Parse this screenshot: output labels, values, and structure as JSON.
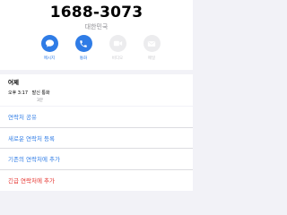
{
  "contact": {
    "phone_number": "1688-3073",
    "country": "대한민국"
  },
  "actions": [
    {
      "label": "메시지",
      "icon": "message-icon",
      "enabled": true
    },
    {
      "label": "통화",
      "icon": "phone-icon",
      "enabled": true
    },
    {
      "label": "비디오",
      "icon": "video-icon",
      "enabled": false
    },
    {
      "label": "메일",
      "icon": "mail-icon",
      "enabled": false
    }
  ],
  "history": {
    "date": "어제",
    "time": "오후 3:17",
    "type": "발신 통화",
    "duration": "3분"
  },
  "menu": {
    "share": "연락처 공유",
    "new_contact": "새로운 연락처 등록",
    "add_existing": "기존의 연락처에 추가",
    "add_emergency": "긴급 연락처에 추가"
  },
  "colors": {
    "accent": "#2f7ce6",
    "danger": "#e5322d",
    "background": "#f2f2f7"
  }
}
